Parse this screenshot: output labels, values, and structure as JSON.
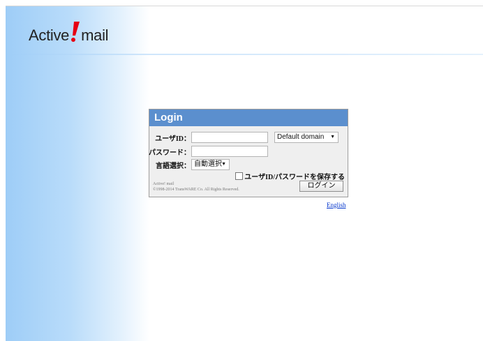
{
  "logo": {
    "text_left": "Active",
    "text_right": "mail",
    "mark": "!"
  },
  "login": {
    "title": "Login",
    "user_id_label": "ユーザID：",
    "user_id_value": "",
    "domain_value": "Default domain",
    "password_label": "パスワード：",
    "password_value": "",
    "language_label": "言語選択：",
    "language_value": "自動選択",
    "remember_label": "ユーザID/パスワードを保存する",
    "remember_checked": false,
    "copyright_line1": "Active! mail",
    "copyright_line2": "©1998-2014 TransWARE Co. All Rights Reserved.",
    "login_button": "ログイン"
  },
  "language_link": "English",
  "colors": {
    "header_blue": "#5b8fce",
    "logo_red": "#e60012",
    "link_blue": "#0033cc"
  }
}
